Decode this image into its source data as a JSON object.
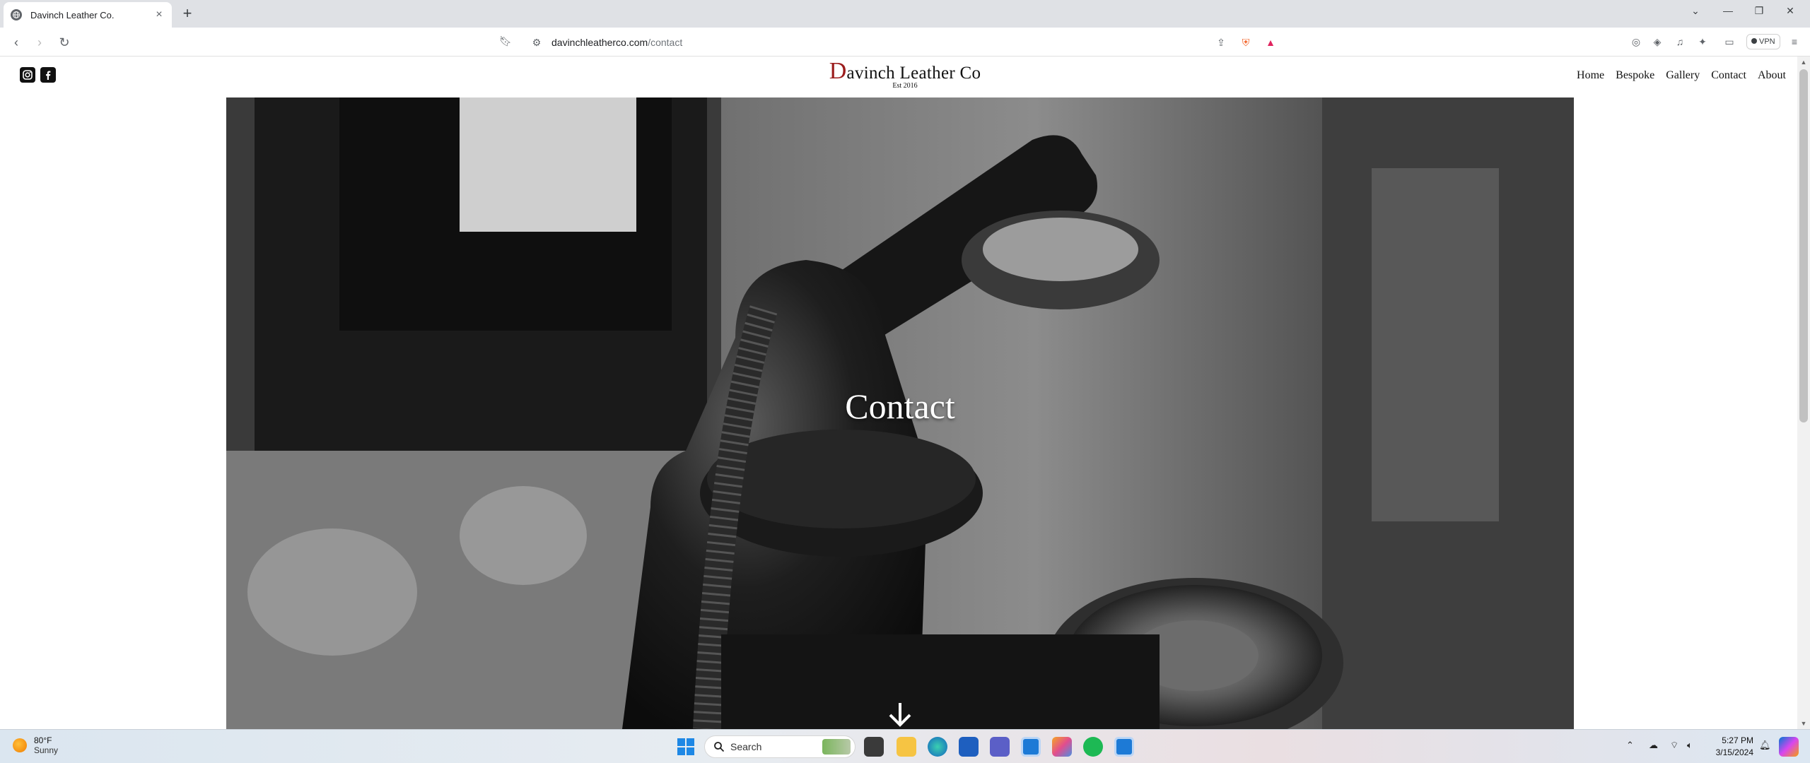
{
  "browser": {
    "tab_title": "Davinch Leather Co.",
    "url_host": "davinchleatherco.com",
    "url_path": "/contact",
    "vpn_label": "VPN"
  },
  "site": {
    "brand_initial": "D",
    "brand_rest": "avinch Leather Co",
    "established": "Est 2016",
    "nav": [
      "Home",
      "Bespoke",
      "Gallery",
      "Contact",
      "About"
    ],
    "hero_title": "Contact"
  },
  "taskbar": {
    "temperature": "80°F",
    "condition": "Sunny",
    "search_placeholder": "Search",
    "time": "5:27 PM",
    "date": "3/15/2024"
  },
  "colors": {
    "brand_initial": "#9b1c1c",
    "tab_strip": "#dfe1e5"
  }
}
